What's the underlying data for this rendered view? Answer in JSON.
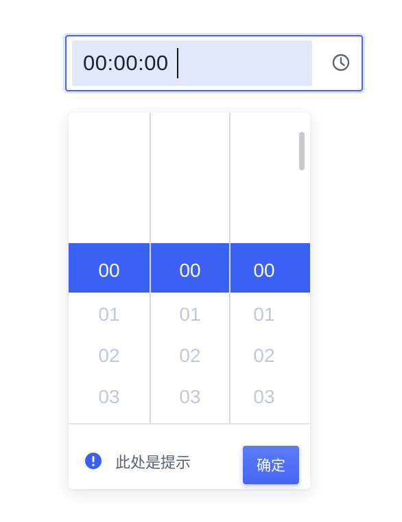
{
  "time_input": {
    "value": "00:00:00",
    "clock_icon": "clock-icon"
  },
  "picker": {
    "columns": [
      {
        "name": "hours",
        "selected": "00",
        "options": [
          "01",
          "02",
          "03"
        ]
      },
      {
        "name": "minutes",
        "selected": "00",
        "options": [
          "01",
          "02",
          "03"
        ]
      },
      {
        "name": "seconds",
        "selected": "00",
        "options": [
          "01",
          "02",
          "03"
        ]
      }
    ],
    "footer": {
      "hint_icon": "info-icon",
      "hint_text": "此处是提示",
      "confirm_label": "确定"
    }
  },
  "colors": {
    "accent": "#3b60f4",
    "input_border": "#4a63e8",
    "input_fill": "#e1e8fb",
    "muted_text": "#c3c8d6"
  }
}
